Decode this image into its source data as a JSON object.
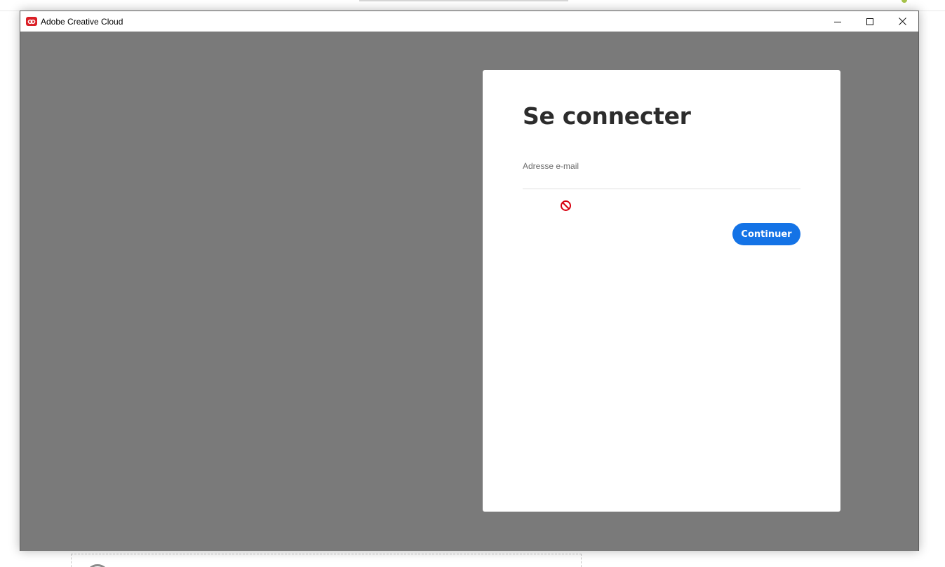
{
  "window": {
    "title": "Adobe Creative Cloud",
    "app_icon": "creative-cloud-logo",
    "controls": [
      "minimize-icon",
      "maximize-icon",
      "close-icon"
    ]
  },
  "login": {
    "heading": "Se connecter",
    "email_label": "Adresse e-mail",
    "email_value": "",
    "error_icon": "blocked-icon",
    "continue_label": "Continuer"
  },
  "colors": {
    "accent": "#1473e6",
    "error": "#d7000f",
    "brand": "#da1f26",
    "backdrop": "#7a7a7a"
  }
}
